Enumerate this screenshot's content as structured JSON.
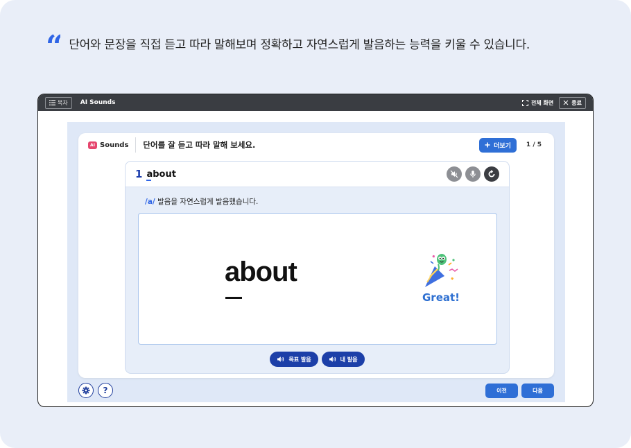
{
  "caption": {
    "quote_icon": "quote-icon",
    "text": "단어와 문장을 직접 듣고 따라 말해보며 정확하고 자연스럽게 발음하는 능력을 키울 수 있습니다."
  },
  "topbar": {
    "toc_label": "목차",
    "app_name": "AI Sounds",
    "fullscreen_label": "전체 화면",
    "end_label": "종료"
  },
  "panel": {
    "logo_badge": "AI",
    "logo_text": "Sounds",
    "instruction": "단어를 잘 듣고 따라 말해 보세요.",
    "more_label": "더보기",
    "pager": "1 / 5"
  },
  "word_card": {
    "number": "1",
    "word_first": "a",
    "word_rest": "bout",
    "feedback_ipa": "/a/",
    "feedback_text": " 발음을 자연스럽게 발음했습니다.",
    "display_word": "about",
    "result_label": "Great!",
    "target_audio_label": "목표 발음",
    "my_audio_label": "내 발음"
  },
  "footer": {
    "help_label": "?",
    "prev_label": "이전",
    "next_label": "다음"
  },
  "colors": {
    "accent": "#2f6fd6",
    "dark_navy": "#1c3fa8",
    "background": "#e9eef8",
    "topbar": "#3a3d42"
  }
}
